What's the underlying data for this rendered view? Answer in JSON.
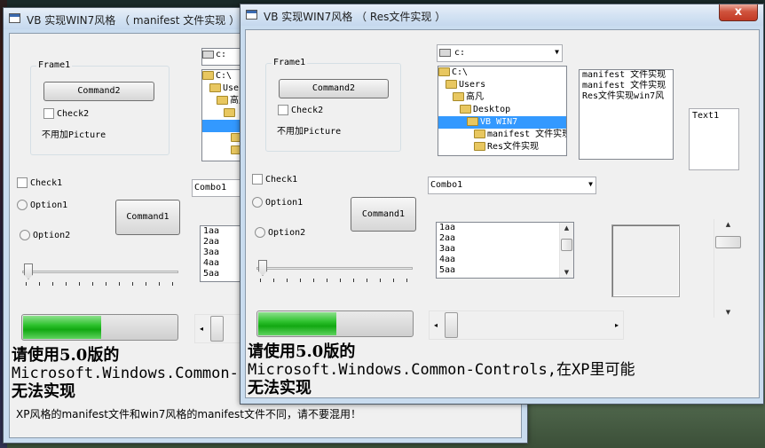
{
  "window_back": {
    "title": "VB 实现WIN7风格 （ manifest 文件实现 ）",
    "frame_label": "Frame1",
    "command2": "Command2",
    "check2": "Check2",
    "no_picture": "不用加Picture",
    "check1": "Check1",
    "option1": "Option1",
    "option2": "Option2",
    "command1": "Command1",
    "combo_value": "Combo1",
    "drive": "c:",
    "tree": [
      "C:\\",
      "Users",
      "高凡"
    ],
    "list_items": [
      "1aa",
      "2aa",
      "3aa",
      "4aa",
      "5aa"
    ],
    "progress": 0.5,
    "hscroll_value": 0.0,
    "big_line1": "请使用5.0版的",
    "big_line2": "Microsoft.Windows.Common-Controls,在XP里可能",
    "big_line3": "无法实现",
    "note": "XP风格的manifest文件和win7风格的manifest文件不同，请不要混用！"
  },
  "window_front": {
    "title": "VB 实现WIN7风格 （ Res文件实现 ）",
    "close_label": "x",
    "frame_label": "Frame1",
    "command2": "Command2",
    "check2": "Check2",
    "no_picture": "不用加Picture",
    "check1": "Check1",
    "option1": "Option1",
    "option2": "Option2",
    "command1": "Command1",
    "combo_value": "Combo1",
    "drive": "c:",
    "tree": [
      "C:\\",
      "Users",
      "高凡",
      "Desktop",
      "VB WIN7",
      "manifest 文件实现",
      "Res文件实现"
    ],
    "tree_selected": "VB WIN7",
    "file_list": [
      "manifest 文件实现",
      "manifest 文件实现",
      "Res文件实现win7风"
    ],
    "text1": "Text1",
    "list_items": [
      "1aa",
      "2aa",
      "3aa",
      "4aa",
      "5aa"
    ],
    "progress": 0.5,
    "hscroll_value": 0.0,
    "big_line1": "请使用5.0版的",
    "big_line2": "Microsoft.Windows.Common-Controls,在XP里可能",
    "big_line3": "无法实现"
  },
  "colors": {
    "progress_green": "#12a812",
    "selection": "#3399ff",
    "close_button": "#c23a25"
  }
}
